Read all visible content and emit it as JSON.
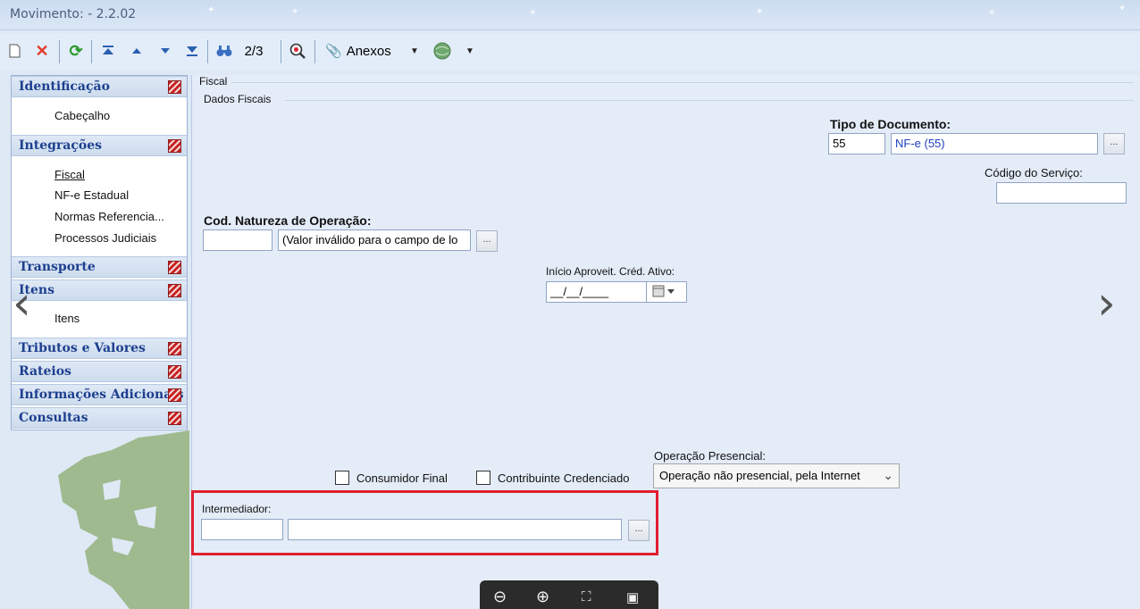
{
  "window": {
    "title": "Movimento:  - 2.2.02"
  },
  "toolbar": {
    "record_counter": "2/3",
    "attachments_label": "Anexos"
  },
  "sidebar": {
    "sections": [
      {
        "label": "Identificação"
      },
      {
        "label": "Integrações"
      },
      {
        "label": "Transporte"
      },
      {
        "label": "Itens"
      },
      {
        "label": "Tributos e Valores"
      },
      {
        "label": "Rateios"
      },
      {
        "label": "Informações Adicionais"
      },
      {
        "label": "Consultas"
      }
    ],
    "items": [
      {
        "label": "Cabeçalho"
      },
      {
        "label": "Fiscal",
        "selected": true
      },
      {
        "label": "NF-e Estadual"
      },
      {
        "label": "Normas Referencia..."
      },
      {
        "label": "Processos Judiciais"
      },
      {
        "label": "Itens"
      }
    ]
  },
  "form": {
    "tab_label": "Fiscal",
    "group_label": "Dados Fiscais",
    "tipo_documento": {
      "label": "Tipo de Documento:",
      "code": "55",
      "description": "NF-e (55)"
    },
    "codigo_servico": {
      "label": "Código do Serviço:",
      "value": ""
    },
    "natureza_operacao": {
      "label": "Cod. Natureza de Operação:",
      "code": "",
      "description": "(Valor inválido para o campo de lo"
    },
    "inicio_aproveit": {
      "label": "Início Aproveit. Créd. Ativo:",
      "value": "__/__/____"
    },
    "consumidor_final": {
      "label": "Consumidor Final",
      "checked": false
    },
    "contribuinte_credenciado": {
      "label": "Contribuinte Credenciado",
      "checked": false
    },
    "operacao_presencial": {
      "label": "Operação Presencial:",
      "value": "Operação não presencial, pela Internet"
    },
    "intermediador": {
      "label": "Intermediador:",
      "code": "",
      "name": ""
    },
    "lookup_button": "..."
  },
  "colors": {
    "highlight": "#e01f2f",
    "section_text": "#1d3f8f"
  },
  "icons": [
    "new-icon",
    "delete-icon",
    "refresh-icon",
    "first-icon",
    "previous-icon",
    "next-icon",
    "last-icon",
    "binoculars-icon",
    "search-zoom-icon",
    "paperclip-icon",
    "globe-icon",
    "calendar-icon",
    "zoom-out-icon",
    "zoom-in-icon",
    "fullscreen-icon",
    "slideshow-icon"
  ]
}
